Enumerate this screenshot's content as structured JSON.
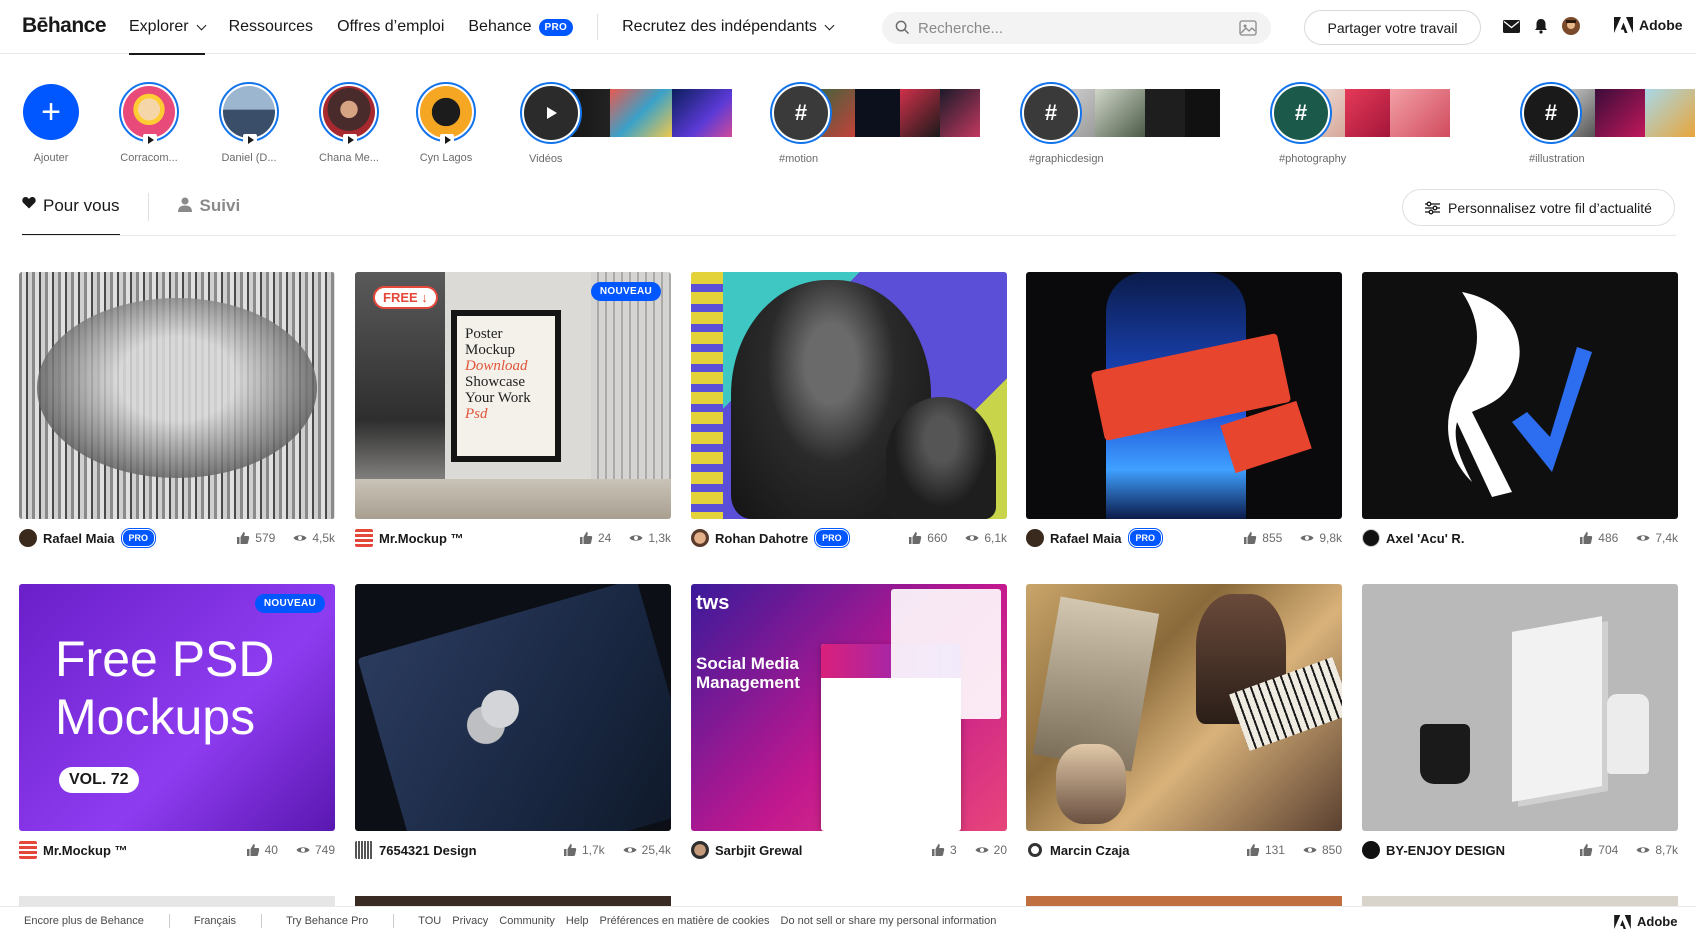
{
  "header": {
    "logo": "Bēhance",
    "nav": [
      {
        "label": "Explorer",
        "dropdown": true,
        "active": true
      },
      {
        "label": "Ressources"
      },
      {
        "label": "Offres d’emploi"
      },
      {
        "label": "Behance",
        "badge": "PRO"
      },
      {
        "label": "Recrutez des indépendants",
        "dropdown": true
      }
    ],
    "search_placeholder": "Recherche...",
    "share_label": "Partager votre travail",
    "adobe_label": "Adobe"
  },
  "stories": {
    "add_label": "Ajouter",
    "creators": [
      {
        "label": "Corracom..."
      },
      {
        "label": "Daniel (D..."
      },
      {
        "label": "Chana Me..."
      },
      {
        "label": "Cyn Lagos"
      },
      {
        "label": "Vidéos"
      }
    ],
    "tags": [
      "#motion",
      "#graphicdesign",
      "#photography",
      "#illustration"
    ]
  },
  "tabs": {
    "for_you": "Pour vous",
    "following": "Suivi",
    "personalize": "Personnalisez votre fil d’actualité"
  },
  "projects": [
    {
      "owner": "Rafael Maia",
      "pro": true,
      "likes": "579",
      "views": "4,5k",
      "new": false
    },
    {
      "owner": "Mr.Mockup ™",
      "pro": false,
      "likes": "24",
      "views": "1,3k",
      "new": true
    },
    {
      "owner": "Rohan Dahotre",
      "pro": true,
      "likes": "660",
      "views": "6,1k",
      "new": false
    },
    {
      "owner": "Rafael Maia",
      "pro": true,
      "likes": "855",
      "views": "9,8k",
      "new": false
    },
    {
      "owner": "Axel 'Acu' R.",
      "pro": false,
      "likes": "486",
      "views": "7,4k",
      "new": false
    },
    {
      "owner": "Mr.Mockup ™",
      "pro": false,
      "likes": "40",
      "views": "749",
      "new": true
    },
    {
      "owner": "7654321 Design",
      "pro": false,
      "likes": "1,7k",
      "views": "25,4k",
      "new": false
    },
    {
      "owner": "Sarbjit Grewal",
      "pro": false,
      "likes": "3",
      "views": "20",
      "new": false
    },
    {
      "owner": "Marcin Czaja",
      "pro": false,
      "likes": "131",
      "views": "850",
      "new": false
    },
    {
      "owner": "BY-ENJOY DESIGN",
      "pro": false,
      "likes": "704",
      "views": "8,7k",
      "new": false
    }
  ],
  "thumb_text": {
    "poster_free": "FREE ↓",
    "poster_line1": "Poster",
    "poster_line2": "Mockup",
    "poster_line3": "Download",
    "poster_line4": "Showcase",
    "poster_line5": "Your Work",
    "poster_line6": "Psd",
    "psd_title1": "Free PSD",
    "psd_title2": "Mockups",
    "psd_vol": "VOL. 72",
    "social_brand": "tws",
    "social_title1": "Social Media",
    "social_title2": "Management",
    "badge_new": "NOUVEAU"
  },
  "footer": {
    "items_left": [
      "Encore plus de Behance",
      "Français",
      "Try Behance Pro"
    ],
    "links": [
      "TOU",
      "Privacy",
      "Community",
      "Help",
      "Préférences en matière de cookies",
      "Do not sell or share my personal information"
    ],
    "adobe": "Adobe"
  },
  "colors": {
    "accent": "#0057ff",
    "story_ring": "#1273eb"
  }
}
